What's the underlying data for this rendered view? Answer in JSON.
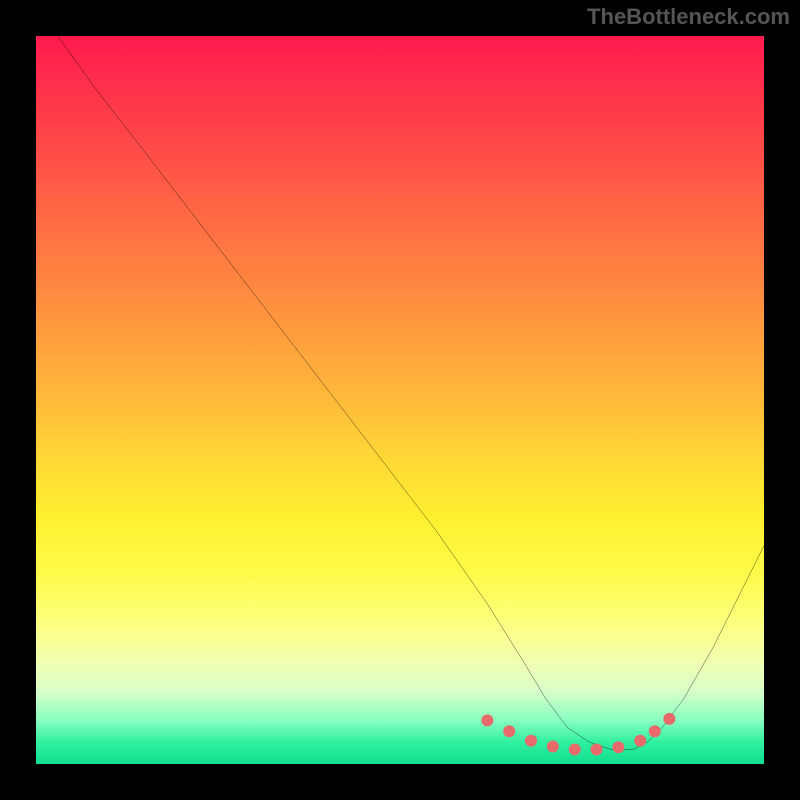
{
  "watermark": "TheBottleneck.com",
  "chart_data": {
    "type": "line",
    "title": "",
    "xlabel": "",
    "ylabel": "",
    "xlim": [
      0,
      100
    ],
    "ylim": [
      0,
      100
    ],
    "series": [
      {
        "name": "curve",
        "x": [
          3,
          8,
          15,
          25,
          35,
          45,
          55,
          62,
          67,
          70,
          73,
          76,
          79,
          82,
          84,
          86,
          89,
          93,
          97,
          100
        ],
        "values": [
          100,
          93,
          84,
          71,
          58,
          45,
          32,
          22,
          14,
          9,
          5,
          3,
          2,
          2,
          3,
          5,
          9,
          16,
          24,
          30
        ]
      }
    ],
    "markers": {
      "name": "sweet-spot",
      "x": [
        62,
        65,
        68,
        71,
        74,
        77,
        80,
        83,
        85,
        87
      ],
      "values": [
        6,
        4.5,
        3.2,
        2.4,
        2,
        2,
        2.3,
        3.2,
        4.5,
        6.2
      ],
      "color": "#e86a6a",
      "radius_px": 6
    },
    "gradient_stops": [
      {
        "offset": 0,
        "color": "#ff1a4d"
      },
      {
        "offset": 50,
        "color": "#ffba3a"
      },
      {
        "offset": 80,
        "color": "#fdff7a"
      },
      {
        "offset": 100,
        "color": "#10df90"
      }
    ]
  }
}
